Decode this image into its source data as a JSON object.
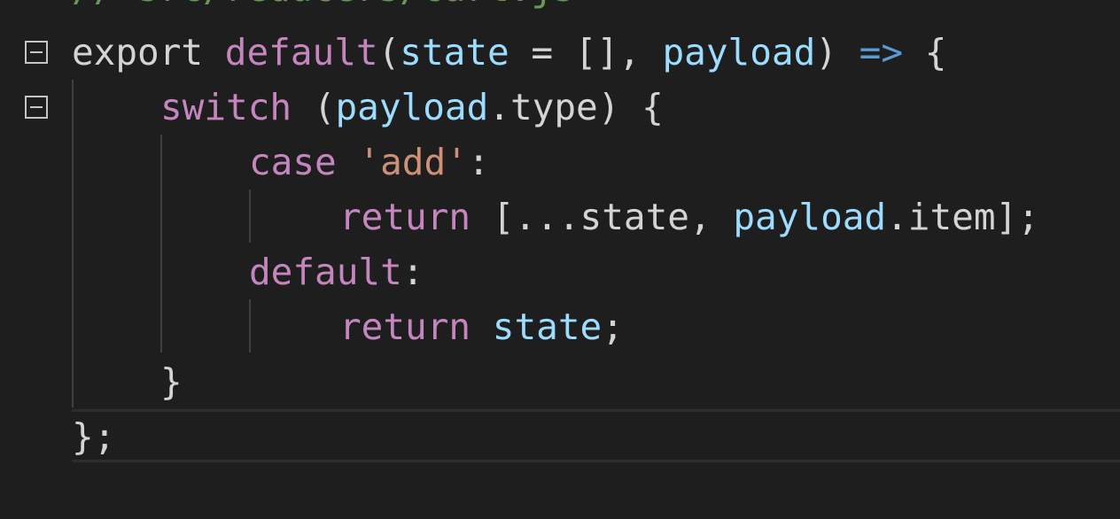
{
  "editor": {
    "comment_line": "// src/reducers/cart.js",
    "lines": [
      {
        "tokens": [
          "export",
          " ",
          "default",
          "(",
          "state",
          " = [], ",
          "payload",
          ") ",
          "=>",
          " {"
        ]
      },
      {
        "tokens": [
          "switch",
          " (",
          "payload",
          ".type) {"
        ]
      },
      {
        "tokens": [
          "case",
          " ",
          "'add'",
          ":"
        ]
      },
      {
        "tokens": [
          "return",
          " [...state, ",
          "payload",
          ".item];"
        ]
      },
      {
        "tokens": [
          "default",
          ":"
        ]
      },
      {
        "tokens": [
          "return",
          " ",
          "state",
          ";"
        ]
      },
      {
        "tokens": [
          "}"
        ]
      },
      {
        "tokens": [
          "};"
        ]
      }
    ]
  },
  "colors": {
    "background": "#1e1e1e",
    "keyword": "#c586c0",
    "variable": "#9cdcfe",
    "arrow": "#569cd6",
    "string": "#ce9178",
    "comment": "#6a9955",
    "plain": "#d4d4d4"
  },
  "icons": {
    "fold": "fold-collapse-icon"
  }
}
